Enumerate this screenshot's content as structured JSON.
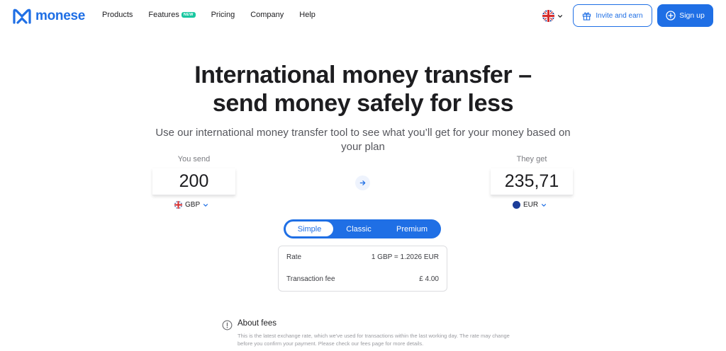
{
  "nav": {
    "logo_text": "monese",
    "menu": [
      {
        "label": "Products"
      },
      {
        "label": "Features",
        "badge": "NEW"
      },
      {
        "label": "Pricing"
      },
      {
        "label": "Company"
      },
      {
        "label": "Help"
      }
    ],
    "invite_label": "Invite and earn",
    "signup_label": "Sign up"
  },
  "hero": {
    "headline_line1": "International money transfer –",
    "headline_line2": "send money safely for less",
    "subline": "Use our international money transfer tool to see what you’ll get for your money based on your plan"
  },
  "converter": {
    "send_label": "You send",
    "send_amount": "200",
    "send_currency": "GBP",
    "get_label": "They get",
    "get_amount": "235,71",
    "get_currency": "EUR"
  },
  "plans": {
    "items": [
      "Simple",
      "Classic",
      "Premium"
    ],
    "selected": "Simple"
  },
  "rates": {
    "rate_label": "Rate",
    "rate_value": "1 GBP = 1.2026 EUR",
    "fee_label": "Transaction fee",
    "fee_value": "£ 4.00"
  },
  "fees": {
    "title": "About fees",
    "text": "This is the latest exchange rate, which we've used for transactions within the last working day. The rate may change before you confirm your payment. Please check our fees page for more details."
  },
  "colors": {
    "brand_blue": "#1f6fe5",
    "badge_green": "#18c7a0",
    "text_dark": "#1d1d20"
  }
}
